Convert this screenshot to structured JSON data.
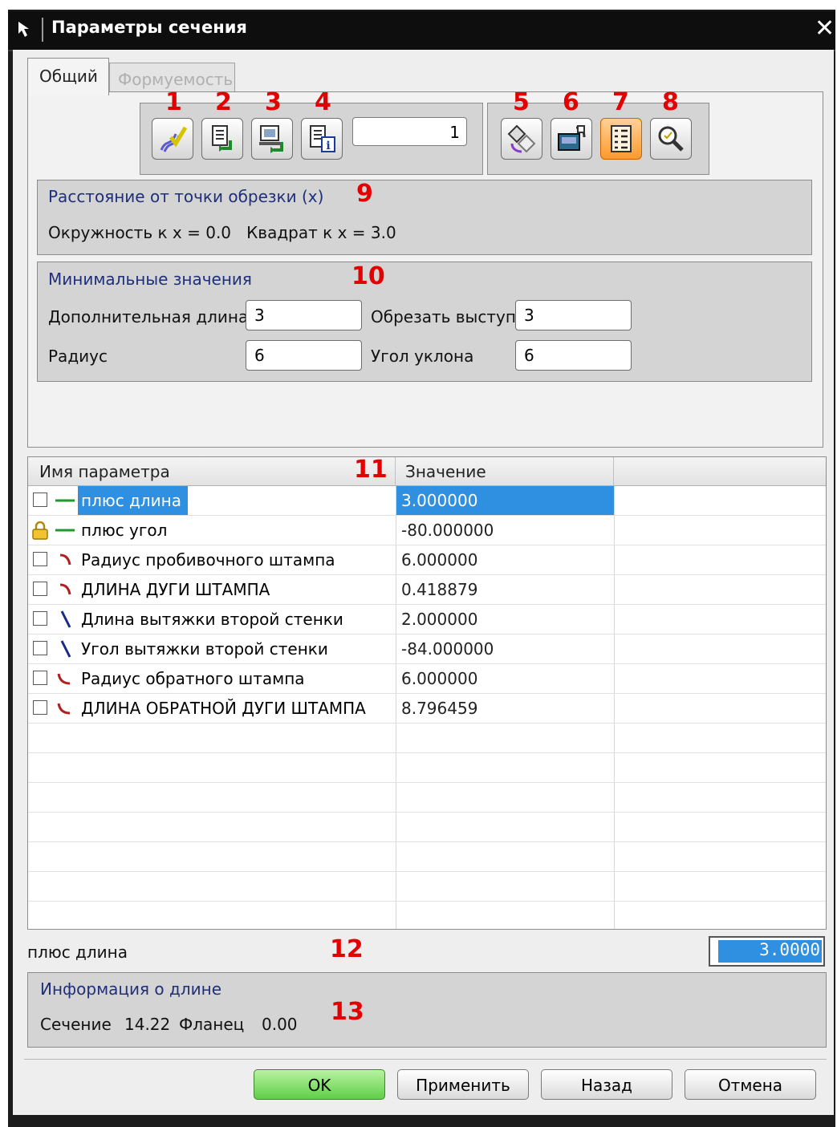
{
  "window": {
    "title": "Параметры сечения"
  },
  "tabs": [
    {
      "label": "Общий",
      "active": true
    },
    {
      "label": "Формуемость",
      "active": false
    }
  ],
  "toolbar": {
    "left_numbers": [
      "1",
      "2",
      "3",
      "4"
    ],
    "left_icons": [
      "curve-check-icon",
      "list-down-icon",
      "monitor-arrow-icon",
      "info-grid-icon"
    ],
    "counter_value": "1",
    "right_numbers": [
      "5",
      "6",
      "7",
      "8"
    ],
    "right_icons": [
      "rotate-shapes-icon",
      "keyboard-icon",
      "list-icon",
      "zoom-icon"
    ]
  },
  "trim_section": {
    "title": "Расстояние от точки обрезки (x)",
    "marker": "9",
    "text": "Окружность к x = 0.0   Квадрат к x = 3.0"
  },
  "minimums": {
    "title": "Минимальные значения",
    "marker": "10",
    "extra_length_label": "Дополнительная длина",
    "extra_length_value": "3",
    "trim_label": "Обрезать выступ",
    "trim_value": "3",
    "radius_label": "Радиус",
    "radius_value": "6",
    "draft_label": "Угол уклона",
    "draft_value": "6"
  },
  "table": {
    "marker": "11",
    "col_name": "Имя параметра",
    "col_value": "Значение",
    "rows": [
      {
        "name": "плюс длина",
        "value": "3.000000",
        "icon": "green-line-icon",
        "selected": true
      },
      {
        "name": "плюс угол",
        "value": "-80.000000",
        "icon": "lock-icon",
        "selected": false
      },
      {
        "name": "Радиус пробивочного штампа",
        "value": "6.000000",
        "icon": "red-arc-icon",
        "selected": false
      },
      {
        "name": "ДЛИНА ДУГИ ШТАМПА",
        "value": "0.418879",
        "icon": "red-arc-icon",
        "selected": false
      },
      {
        "name": "Длина вытяжки второй стенки",
        "value": "2.000000",
        "icon": "blue-slash-icon",
        "selected": false
      },
      {
        "name": "Угол вытяжки второй стенки",
        "value": "-84.000000",
        "icon": "blue-slash-icon",
        "selected": false
      },
      {
        "name": "Радиус обратного штампа",
        "value": "6.000000",
        "icon": "red-hook-icon",
        "selected": false
      },
      {
        "name": "ДЛИНА ОБРАТНОЙ ДУГИ ШТАМПА",
        "value": "8.796459",
        "icon": "red-hook-icon",
        "selected": false
      }
    ]
  },
  "edit": {
    "label": "плюс длина",
    "marker": "12",
    "value": "3.0000"
  },
  "length_info": {
    "title": "Информация о длине",
    "marker": "13",
    "section_label": "Сечение",
    "section_value": "14.22",
    "flange_label": "Фланец",
    "flange_value": "0.00"
  },
  "buttons": {
    "ok": "OK",
    "apply": "Применить",
    "back": "Назад",
    "cancel": "Отмена"
  }
}
